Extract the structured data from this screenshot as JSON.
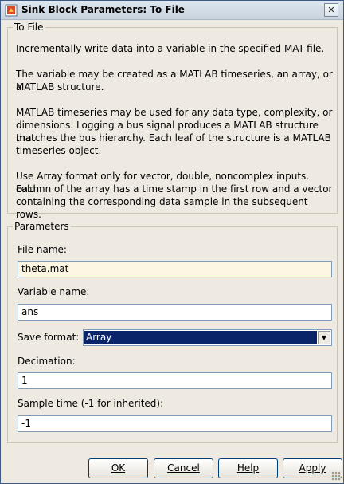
{
  "window": {
    "title": "Sink Block Parameters: To File",
    "close_glyph": "✕",
    "icon": "simulink-block-icon"
  },
  "description_group": {
    "label": "To File",
    "lines": [
      "Incrementally write data into a variable in the specified MAT-file.",
      "The variable may be created as a MATLAB timeseries, an array, or a",
      "MATLAB structure.",
      "MATLAB timeseries may be used for any data type, complexity, or",
      "dimensions. Logging a bus signal produces a MATLAB structure that",
      "matches the bus hierarchy. Each leaf of the structure is a MATLAB",
      "timeseries object.",
      "Use Array format only for vector, double, noncomplex inputs. Each",
      "column of the array has a time stamp in the first row and a vector",
      "containing the corresponding data sample in the subsequent rows."
    ]
  },
  "parameters_group": {
    "label": "Parameters",
    "file_name": {
      "label": "File name:",
      "value": "theta.mat"
    },
    "variable_name": {
      "label": "Variable name:",
      "value": "ans"
    },
    "save_format": {
      "label": "Save format:",
      "value": "Array"
    },
    "decimation": {
      "label": "Decimation:",
      "value": "1"
    },
    "sample_time": {
      "label": "Sample time (-1 for inherited):",
      "value": "-1"
    }
  },
  "buttons": {
    "ok": "OK",
    "cancel": "Cancel",
    "help": "Help",
    "apply": "Apply"
  },
  "colors": {
    "dialog_bg": "#eeeae2",
    "selection": "#0a246a",
    "input_border": "#7f9db9"
  }
}
